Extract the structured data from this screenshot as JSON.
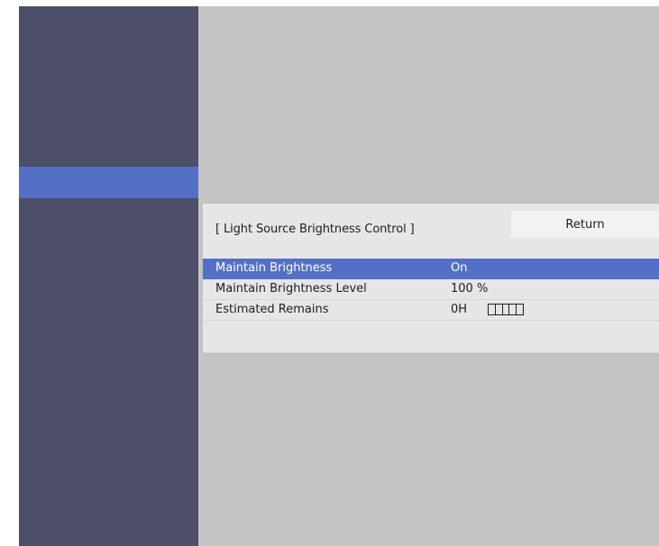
{
  "menu": {
    "title": "[ Light Source Brightness Control ]",
    "return_label": "Return"
  },
  "rows": [
    {
      "label": "Maintain Brightness",
      "value": "On"
    },
    {
      "label": "Maintain Brightness Level",
      "value": "100 %"
    },
    {
      "label": "Estimated Remains",
      "value": "0H"
    }
  ],
  "remaining_indicator": {
    "icon": "battery-gauge-icon",
    "segments": 5,
    "filled_segments": 0
  },
  "colors": {
    "sidebar": "#4d4f68",
    "selection": "#5470c6",
    "background": "#c3c3c3",
    "panel": "#e6e6e6"
  }
}
